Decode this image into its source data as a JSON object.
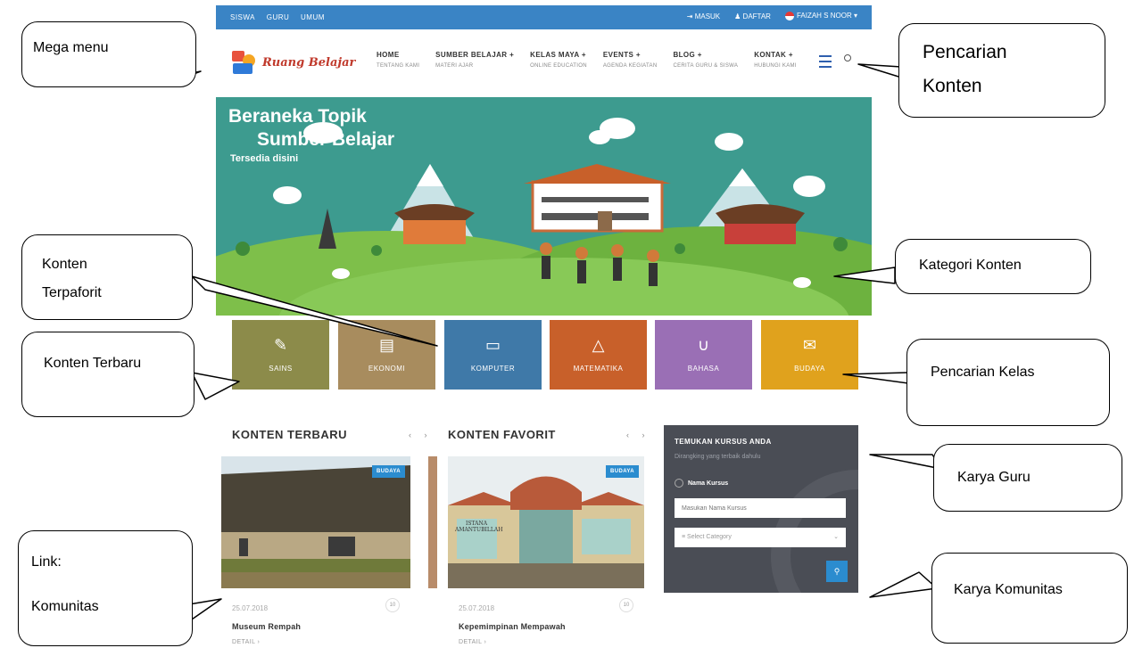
{
  "topbar": {
    "left_links": [
      "SISWA",
      "GURU",
      "UMUM"
    ],
    "login": "MASUK",
    "register": "DAFTAR",
    "user": "FAIZAH S NOOR"
  },
  "logo_text": "Ruang Belajar",
  "menu": [
    {
      "title": "HOME",
      "sub": "TENTANG KAMI"
    },
    {
      "title": "SUMBER BELAJAR  +",
      "sub": "MATERI AJAR"
    },
    {
      "title": "KELAS MAYA  +",
      "sub": "ONLINE EDUCATION"
    },
    {
      "title": "EVENTS  +",
      "sub": "AGENDA KEGIATAN"
    },
    {
      "title": "BLOG  +",
      "sub": "CERITA GURU & SISWA"
    },
    {
      "title": "KONTAK  +",
      "sub": "HUBUNGI KAMI"
    }
  ],
  "hero": {
    "line1": "Beraneka Topik",
    "line2": "Sumber Belajar",
    "line3": "Tersedia disini"
  },
  "categories": [
    {
      "label": "SAINS",
      "icon": "pencil-icon",
      "glyph": "✎",
      "color": "#8c8b4a"
    },
    {
      "label": "EKONOMI",
      "icon": "document-icon",
      "glyph": "▤",
      "color": "#a88c5e"
    },
    {
      "label": "KOMPUTER",
      "icon": "monitor-icon",
      "glyph": "▭",
      "color": "#3f79a8"
    },
    {
      "label": "MATEMATIKA",
      "icon": "compass-icon",
      "glyph": "△",
      "color": "#c8602a"
    },
    {
      "label": "BAHASA",
      "icon": "language-icon",
      "glyph": "∪",
      "color": "#9a6fb5"
    },
    {
      "label": "BUDAYA",
      "icon": "envelope-icon",
      "glyph": "✉",
      "color": "#e0a21d"
    }
  ],
  "latest": {
    "title": "KONTEN TERBARU",
    "arrows": "‹ ›",
    "card": {
      "badge": "BUDAYA",
      "date": "25.07.2018",
      "count": "10",
      "title": "Museum Rempah",
      "detail": "DETAIL ›"
    }
  },
  "favorite": {
    "title": "KONTEN FAVORIT",
    "arrows": "‹ ›",
    "card": {
      "badge": "BUDAYA",
      "date": "25.07.2018",
      "count": "10",
      "title": "Kepemimpinan Mempawah",
      "detail": "DETAIL ›",
      "sign_text": "ISTANA AMANTUBILLAH"
    }
  },
  "course_search": {
    "title": "TEMUKAN KURSUS ANDA",
    "subtitle": "Dirangking yang terbaik dahulu",
    "radio_label": "Nama Kursus",
    "input_placeholder": "Masukan Nama Kursus",
    "select_value": "Select Category",
    "button_icon": "search-icon"
  },
  "annotations": {
    "mega_menu": "Mega menu",
    "search_content_1": "Pencarian",
    "search_content_2": "Konten",
    "category": "Kategori Konten",
    "favorite_1": "Konten",
    "favorite_2": "Terpaforit",
    "latest": "Konten Terbaru",
    "class_search": "Pencarian Kelas",
    "teacher_work": "Karya Guru",
    "community_work": "Karya Komunitas",
    "link_1": "Link:",
    "link_2": "Komunitas"
  }
}
